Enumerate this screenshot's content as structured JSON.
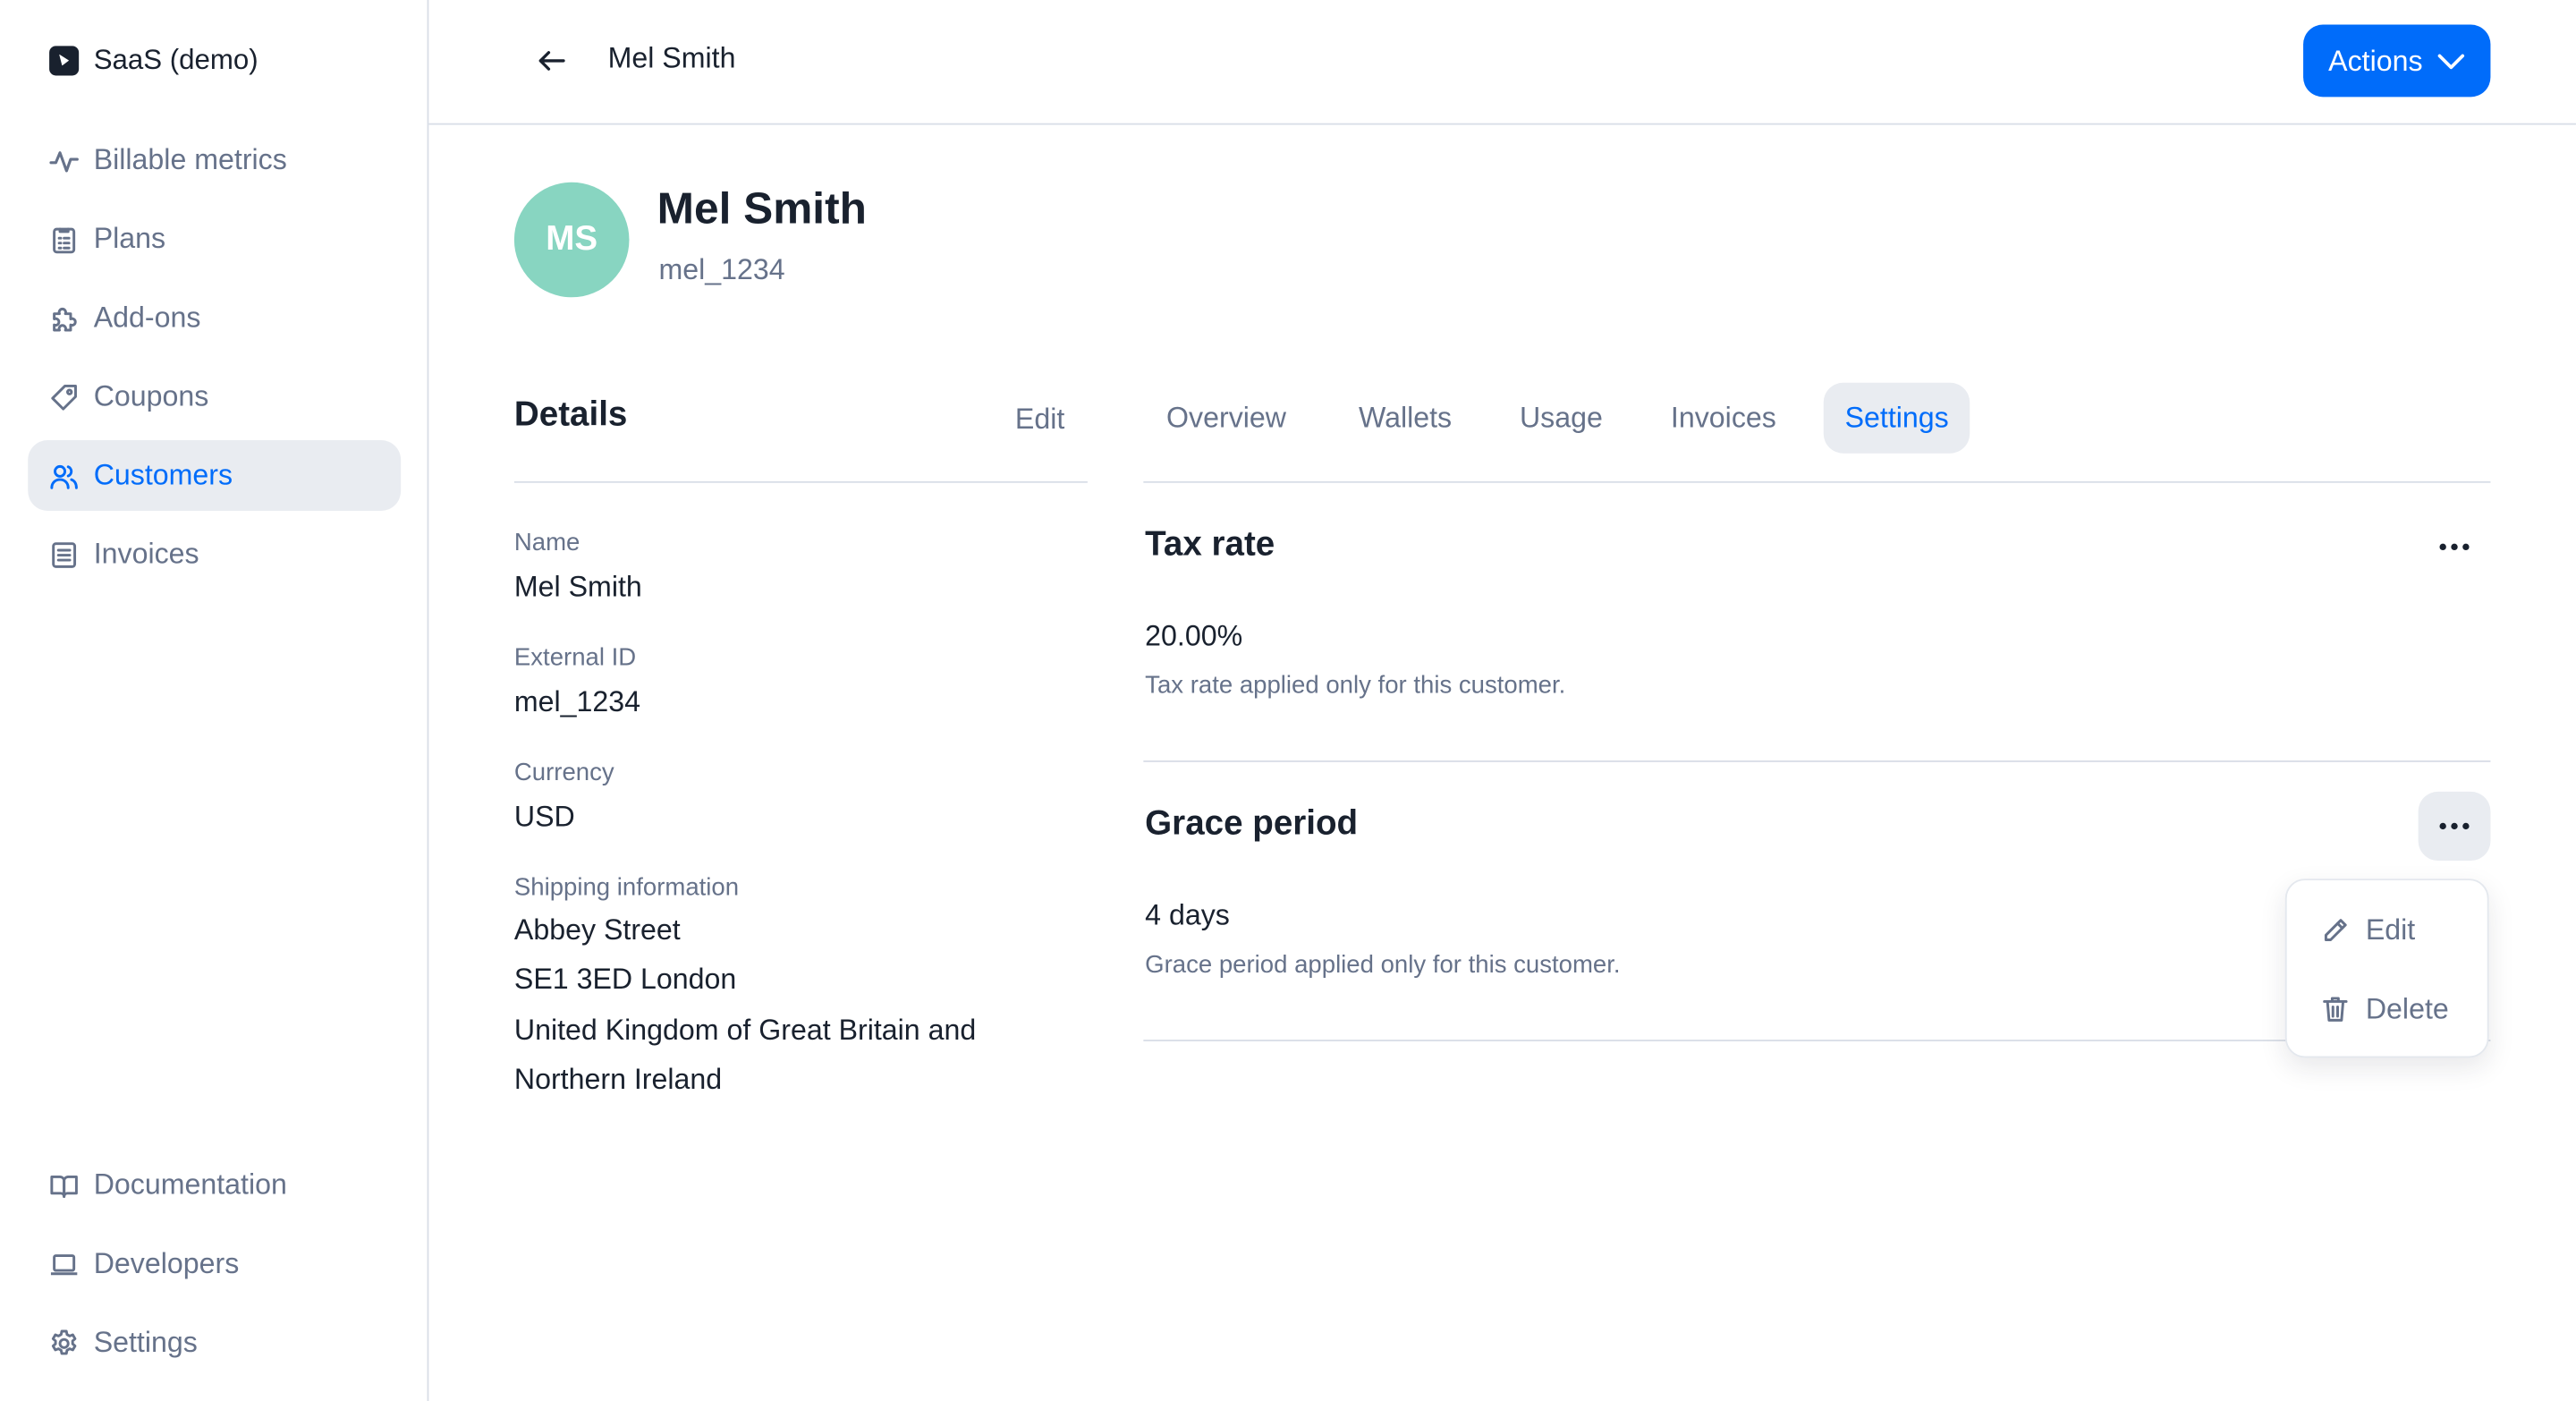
{
  "app": {
    "workspace_name": "SaaS (demo)"
  },
  "sidebar": {
    "items": [
      {
        "label": "Billable metrics",
        "icon": "pulse-icon"
      },
      {
        "label": "Plans",
        "icon": "clipboard-icon"
      },
      {
        "label": "Add-ons",
        "icon": "puzzle-icon"
      },
      {
        "label": "Coupons",
        "icon": "tag-icon"
      },
      {
        "label": "Customers",
        "icon": "users-icon",
        "active": true
      },
      {
        "label": "Invoices",
        "icon": "document-icon"
      }
    ],
    "bottom_items": [
      {
        "label": "Documentation",
        "icon": "book-icon"
      },
      {
        "label": "Developers",
        "icon": "laptop-icon"
      },
      {
        "label": "Settings",
        "icon": "gear-icon"
      }
    ]
  },
  "header": {
    "title": "Mel Smith",
    "actions_label": "Actions"
  },
  "customer": {
    "initials": "MS",
    "name": "Mel Smith",
    "external_id": "mel_1234"
  },
  "details": {
    "title": "Details",
    "edit_label": "Edit",
    "fields": [
      {
        "label": "Name",
        "value": "Mel Smith"
      },
      {
        "label": "External ID",
        "value": "mel_1234"
      },
      {
        "label": "Currency",
        "value": "USD"
      }
    ],
    "shipping": {
      "label": "Shipping information",
      "lines": [
        "Abbey Street",
        "SE1 3ED London",
        "United Kingdom of Great Britain and",
        "Northern Ireland"
      ]
    }
  },
  "tabs": [
    {
      "label": "Overview"
    },
    {
      "label": "Wallets"
    },
    {
      "label": "Usage"
    },
    {
      "label": "Invoices"
    },
    {
      "label": "Settings",
      "active": true
    }
  ],
  "settings": {
    "tax_rate": {
      "title": "Tax rate",
      "value": "20.00%",
      "description": "Tax rate applied only for this customer."
    },
    "grace_period": {
      "title": "Grace period",
      "value": "4 days",
      "description": "Grace period applied only for this customer."
    }
  },
  "menu": {
    "edit_label": "Edit",
    "delete_label": "Delete"
  },
  "colors": {
    "accent": "#006cfa",
    "text": "#19212e",
    "muted": "#66728a",
    "avatar": "#88d5c1",
    "active_bg": "#e9ecf1"
  }
}
